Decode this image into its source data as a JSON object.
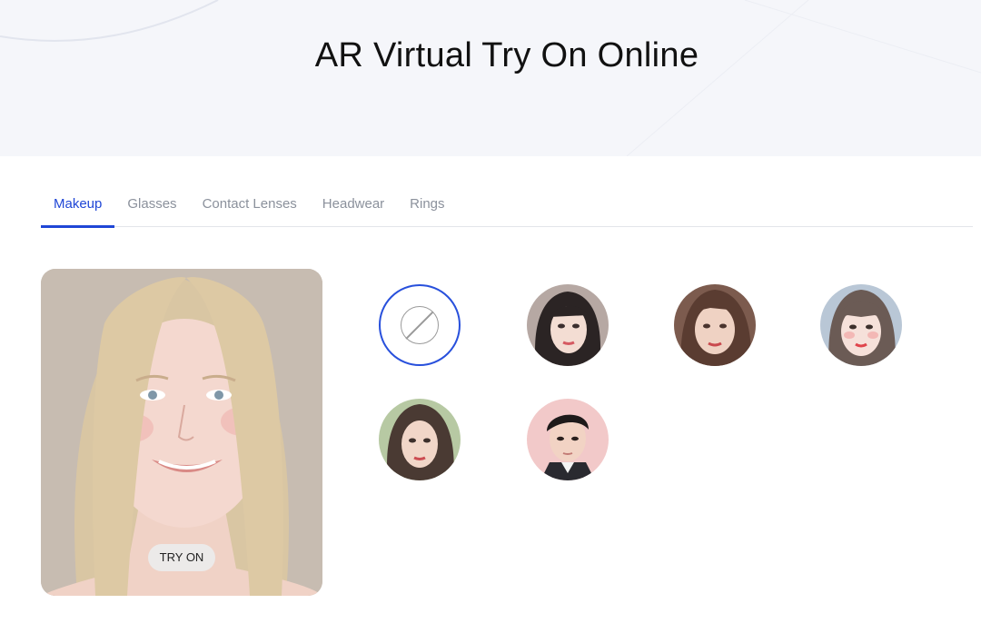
{
  "page": {
    "title": "AR Virtual Try On Online"
  },
  "tabs": [
    {
      "label": "Makeup",
      "active": true
    },
    {
      "label": "Glasses",
      "active": false
    },
    {
      "label": "Contact Lenses",
      "active": false
    },
    {
      "label": "Headwear",
      "active": false
    },
    {
      "label": "Rings",
      "active": false
    }
  ],
  "preview": {
    "button_label": "TRY ON",
    "image": "woman-portrait-photo"
  },
  "makeup_options": [
    {
      "name": "no-makeup",
      "icon": "none-icon",
      "selected": true
    },
    {
      "name": "style-1",
      "icon": "woman-dark-hair-portrait",
      "selected": false
    },
    {
      "name": "style-2",
      "icon": "woman-brown-hair-portrait",
      "selected": false
    },
    {
      "name": "style-3",
      "icon": "woman-bangs-portrait",
      "selected": false
    },
    {
      "name": "style-4",
      "icon": "woman-long-hair-portrait",
      "selected": false
    },
    {
      "name": "style-5",
      "icon": "man-portrait",
      "selected": false
    }
  ],
  "colors": {
    "accent": "#1f46d6",
    "tab_inactive": "#8b919c",
    "hero_bg": "#f5f6fa"
  }
}
